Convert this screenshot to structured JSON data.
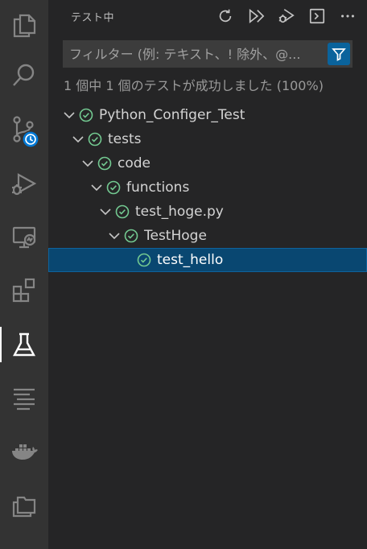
{
  "activity_bar": {
    "items": [
      {
        "name": "explorer",
        "icon": "files-icon"
      },
      {
        "name": "search",
        "icon": "search-icon"
      },
      {
        "name": "source-control",
        "icon": "source-control-icon"
      },
      {
        "name": "run-debug",
        "icon": "run-debug-icon"
      },
      {
        "name": "remote-explorer",
        "icon": "remote-explorer-icon"
      },
      {
        "name": "extensions",
        "icon": "extensions-icon"
      },
      {
        "name": "testing",
        "icon": "beaker-icon"
      },
      {
        "name": "outline",
        "icon": "outline-icon"
      },
      {
        "name": "docker",
        "icon": "docker-icon"
      },
      {
        "name": "project-manager",
        "icon": "folders-icon"
      }
    ]
  },
  "sidebar": {
    "title": "テスト中",
    "toolbar": [
      "refresh-icon",
      "run-all-icon",
      "debug-all-icon",
      "terminal-icon",
      "more-icon"
    ],
    "filter_placeholder": "フィルター (例: テキスト、! 除外、@...",
    "summary": "1 個中 1 個のテストが成功しました (100%)"
  },
  "tree": [
    {
      "label": "Python_Configer_Test",
      "status": "passed",
      "expanded": true
    },
    {
      "label": "tests",
      "status": "passed",
      "expanded": true
    },
    {
      "label": "code",
      "status": "passed",
      "expanded": true
    },
    {
      "label": "functions",
      "status": "passed",
      "expanded": true
    },
    {
      "label": "test_hoge.py",
      "status": "passed",
      "expanded": true
    },
    {
      "label": "TestHoge",
      "status": "passed",
      "expanded": true
    },
    {
      "label": "test_hello",
      "status": "passed",
      "selected": true
    }
  ],
  "colors": {
    "accent": "#0e639c",
    "selection": "#094771",
    "passed": "#73c991",
    "badge": "#0078d4"
  }
}
